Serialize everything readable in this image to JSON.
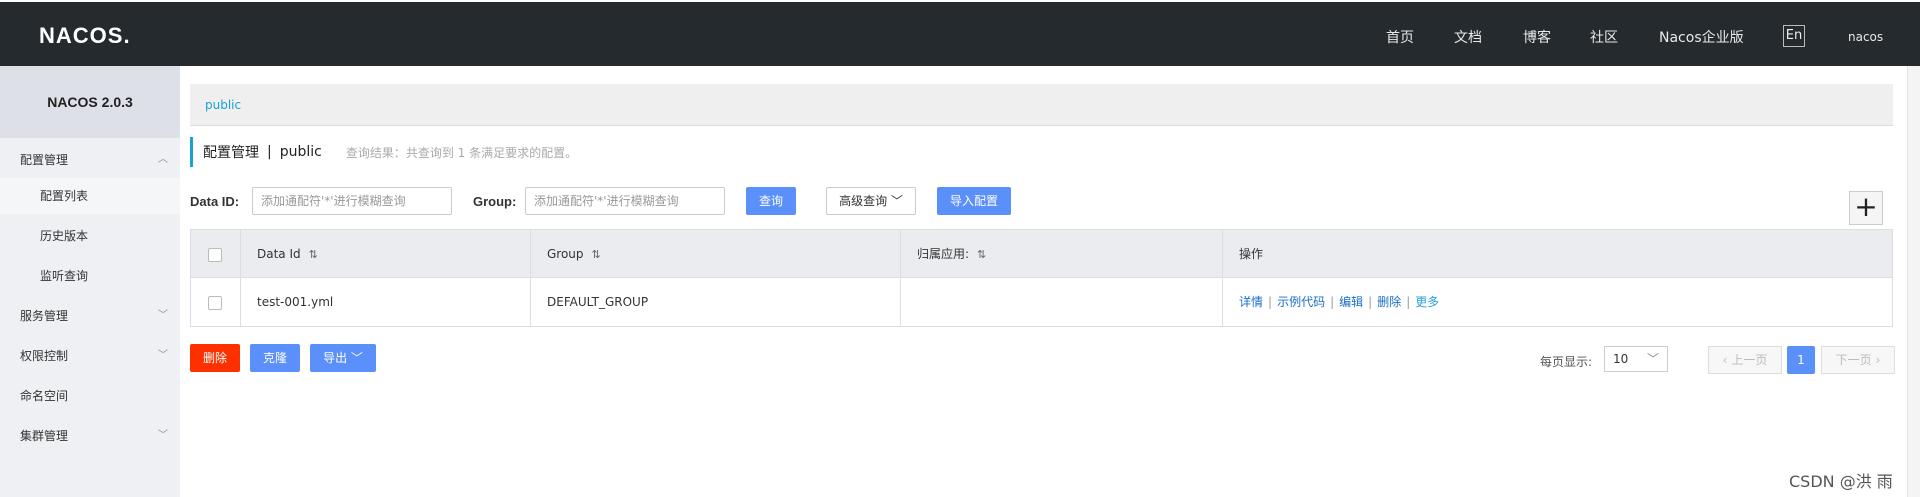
{
  "header": {
    "logo": "NACOS.",
    "nav": [
      "首页",
      "文档",
      "博客",
      "社区",
      "Nacos企业版"
    ],
    "lang": "En",
    "user": "nacos"
  },
  "sidebar": {
    "version": "NACOS 2.0.3",
    "items": [
      {
        "label": "配置管理"
      },
      {
        "label": "配置列表"
      },
      {
        "label": "历史版本"
      },
      {
        "label": "监听查询"
      },
      {
        "label": "服务管理"
      },
      {
        "label": "权限控制"
      },
      {
        "label": "命名空间"
      },
      {
        "label": "集群管理"
      }
    ]
  },
  "main": {
    "namespace_tab": "public",
    "title": "配置管理",
    "separator": "|",
    "namespace": "public",
    "result_text": "查询结果：共查询到 1 条满足要求的配置。",
    "filters": {
      "dataid_label": "Data ID:",
      "dataid_placeholder": "添加通配符'*'进行模糊查询",
      "group_label": "Group:",
      "group_placeholder": "添加通配符'*'进行模糊查询",
      "query_button": "查询",
      "advanced_button": "高级查询",
      "import_button": "导入配置",
      "add_button": "+"
    },
    "table": {
      "columns": [
        "Data Id",
        "Group",
        "归属应用:",
        "操作"
      ],
      "rows": [
        {
          "data_id": "test-001.yml",
          "group": "DEFAULT_GROUP",
          "app": "",
          "actions": [
            "详情",
            "示例代码",
            "编辑",
            "删除",
            "更多"
          ]
        }
      ]
    },
    "bulk": {
      "delete": "删除",
      "clone": "克隆",
      "export": "导出"
    },
    "pager": {
      "page_size_label": "每页显示:",
      "page_size": "10",
      "prev": "上一页",
      "current": "1",
      "next": "下一页"
    }
  },
  "watermark": "CSDN @洪 雨",
  "colors": {
    "topbar": "#252a2f",
    "accent": "#1aa1d4",
    "primary_button": "#5b8ff9",
    "danger_button": "#ff3000"
  }
}
